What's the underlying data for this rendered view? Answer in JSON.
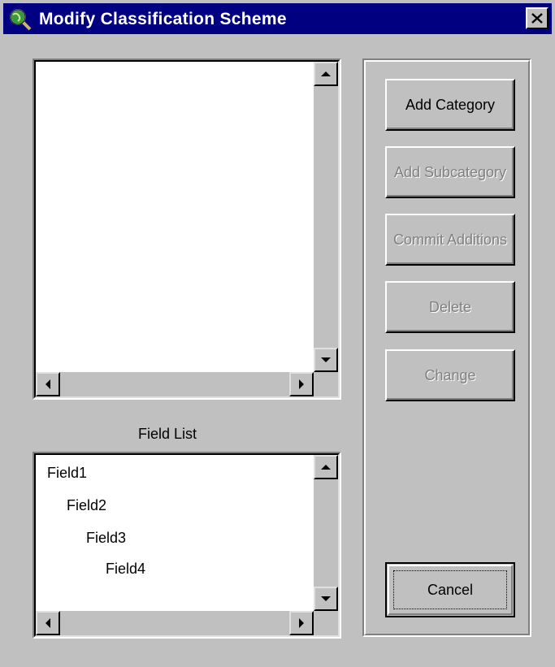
{
  "window": {
    "title": "Modify Classification Scheme"
  },
  "field_list": {
    "label": "Field List",
    "items": [
      "Field1",
      "Field2",
      "Field3",
      "Field4"
    ]
  },
  "buttons": {
    "add_category": "Add Category",
    "add_subcategory": "Add Subcategory",
    "commit_additions": "Commit Additions",
    "delete": "Delete",
    "change": "Change",
    "cancel": "Cancel"
  },
  "colors": {
    "title_bar": "#000080",
    "face": "#c0c0c0",
    "disabled_text": "#808080"
  },
  "icons": {
    "app": "globe-magnifier-icon",
    "close": "close-icon"
  }
}
